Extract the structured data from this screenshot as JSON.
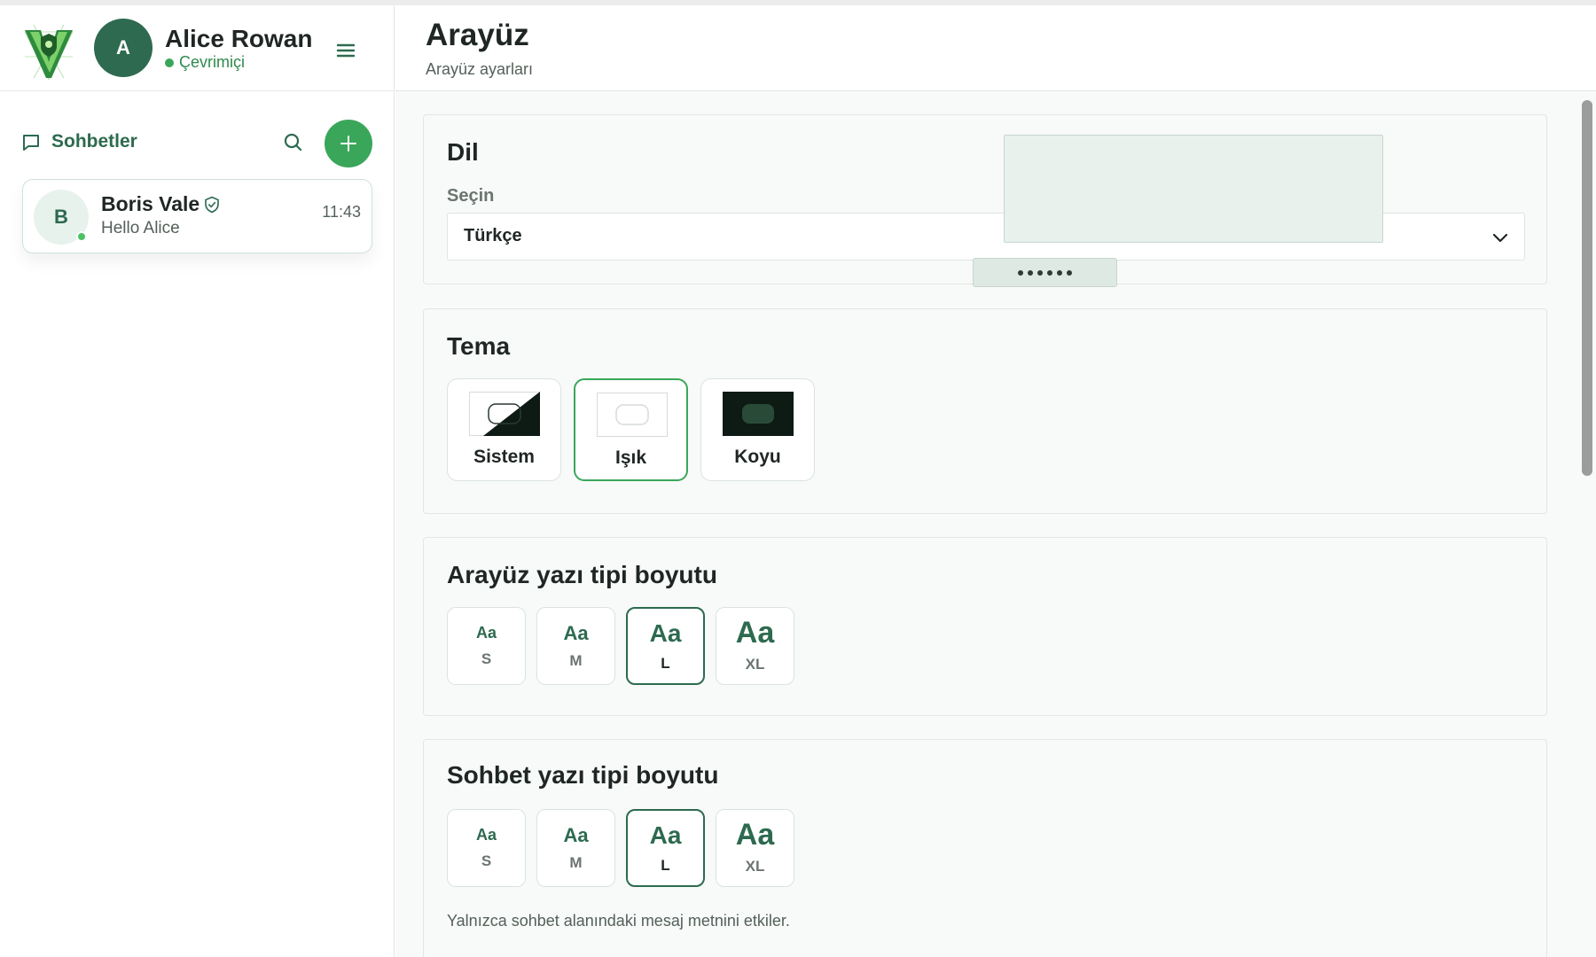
{
  "user": {
    "avatar_initial": "A",
    "name": "Alice Rowan",
    "status": "Çevrimiçi"
  },
  "chats": {
    "title": "Sohbetler",
    "items": [
      {
        "avatar_initial": "B",
        "name": "Boris Vale",
        "last_message": "Hello Alice",
        "time": "11:43",
        "online": true,
        "verified": true
      }
    ]
  },
  "page": {
    "title": "Arayüz",
    "subtitle": "Arayüz ayarları"
  },
  "language": {
    "title": "Dil",
    "label": "Seçin",
    "selected": "Türkçe"
  },
  "theme": {
    "title": "Tema",
    "options": [
      {
        "label": "Sistem",
        "icon": "system-theme-icon",
        "selected": false
      },
      {
        "label": "Işık",
        "icon": "light-theme-icon",
        "selected": true
      },
      {
        "label": "Koyu",
        "icon": "dark-theme-icon",
        "selected": false
      }
    ]
  },
  "ui_font_size": {
    "title": "Arayüz yazı tipi boyutu",
    "options": [
      {
        "sample": "Aa",
        "label": "S",
        "selected": false
      },
      {
        "sample": "Aa",
        "label": "M",
        "selected": false
      },
      {
        "sample": "Aa",
        "label": "L",
        "selected": true
      },
      {
        "sample": "Aa",
        "label": "XL",
        "selected": false
      }
    ]
  },
  "chat_font_size": {
    "title": "Sohbet yazı tipi boyutu",
    "options": [
      {
        "sample": "Aa",
        "label": "S",
        "selected": false
      },
      {
        "sample": "Aa",
        "label": "M",
        "selected": false
      },
      {
        "sample": "Aa",
        "label": "L",
        "selected": true
      },
      {
        "sample": "Aa",
        "label": "XL",
        "selected": false
      }
    ],
    "note": "Yalnızca sohbet alanındaki mesaj metnini etkiler."
  },
  "colors": {
    "brand": "#2d6a4f",
    "accent": "#3aa65a",
    "online": "#4cc265"
  }
}
